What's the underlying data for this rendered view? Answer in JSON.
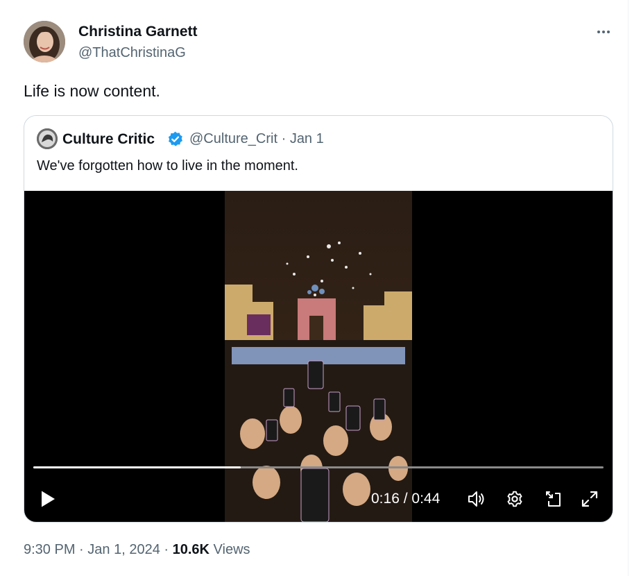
{
  "author": {
    "name": "Christina Garnett",
    "handle": "@ThatChristinaG"
  },
  "tweet": {
    "text": "Life is now content."
  },
  "quoted_tweet": {
    "name": "Culture Critic",
    "handle": "@Culture_Crit",
    "separator": "·",
    "date": "Jan 1",
    "text": "We've forgotten how to live in the moment.",
    "verified": true
  },
  "video": {
    "current_time": "0:16",
    "duration": "0:44",
    "time_separator": "/",
    "progress_fraction": 0.364
  },
  "meta": {
    "time": "9:30 PM",
    "date": "Jan 1, 2024",
    "separator": "·",
    "views_count": "10.6K",
    "views_label": "Views"
  },
  "colors": {
    "text_primary": "#0f1419",
    "text_secondary": "#536471",
    "verified_blue": "#1d9bf0",
    "border": "#cfd9de"
  },
  "icons": {
    "more": "more-icon",
    "verified": "verified-badge-icon",
    "play": "play-icon",
    "volume": "volume-icon",
    "settings": "settings-icon",
    "pip": "picture-in-picture-icon",
    "fullscreen": "fullscreen-icon"
  }
}
